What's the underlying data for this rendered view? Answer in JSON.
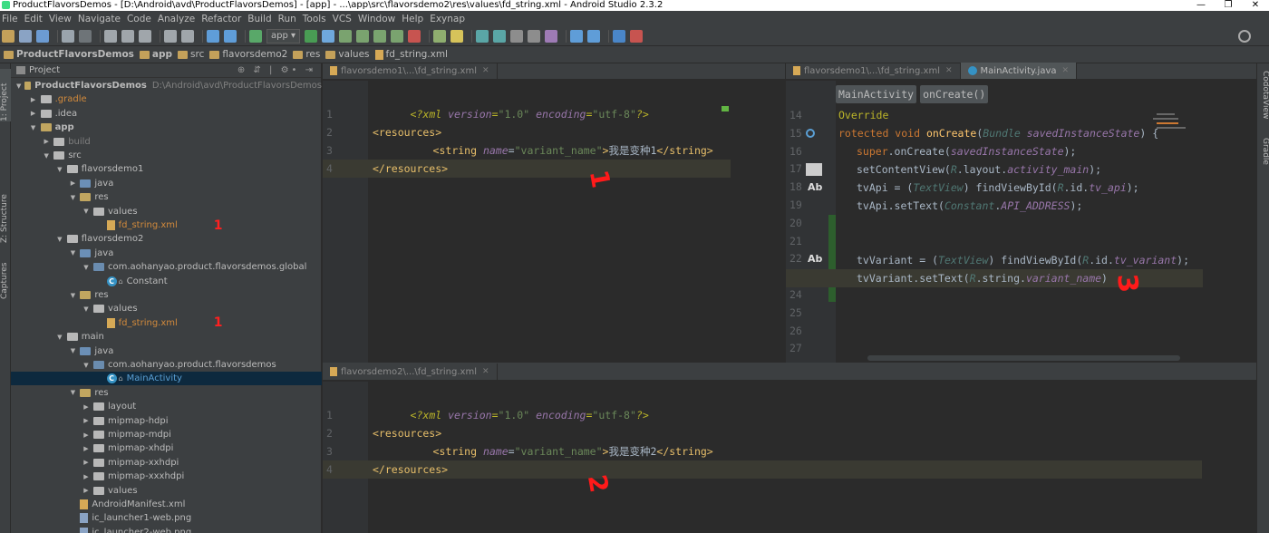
{
  "window": {
    "title": "ProductFlavorsDemos - [D:\\Android\\avd\\ProductFlavorsDemos] - [app] - ...\\app\\src\\flavorsdemo2\\res\\values\\fd_string.xml - Android Studio 2.3.2",
    "controls": [
      "—",
      "❐",
      "✕"
    ]
  },
  "menu": [
    "File",
    "Edit",
    "View",
    "Navigate",
    "Code",
    "Analyze",
    "Refactor",
    "Build",
    "Run",
    "Tools",
    "VCS",
    "Window",
    "Help",
    "Exynap"
  ],
  "toolbar": {
    "run_config": "app ▾"
  },
  "breadcrumb": [
    "ProductFlavorsDemos",
    "app",
    "src",
    "flavorsdemo2",
    "res",
    "values",
    "fd_string.xml"
  ],
  "left_strip": [
    "1: Project",
    "Z: Structure",
    "Captures"
  ],
  "right_strip": [
    "CodotaView",
    "Gradle"
  ],
  "project_panel": {
    "title": "Project",
    "header_icons": "⊕ ⇵ | ⚙• ⇥",
    "tree": [
      {
        "indent": 0,
        "arrow": "▼",
        "icon": "mod",
        "label": "ProductFlavorsDemos",
        "bold": true,
        "extra": "D:\\Android\\avd\\ProductFlavorsDemos"
      },
      {
        "indent": 1,
        "arrow": "▶",
        "icon": "folder",
        "label": ".gradle",
        "color": "orange"
      },
      {
        "indent": 1,
        "arrow": "▶",
        "icon": "folder",
        "label": ".idea"
      },
      {
        "indent": 1,
        "arrow": "▼",
        "icon": "mod",
        "label": "app",
        "bold": true
      },
      {
        "indent": 2,
        "arrow": "▶",
        "icon": "folder",
        "label": "build",
        "color": "muted"
      },
      {
        "indent": 2,
        "arrow": "▼",
        "icon": "folder",
        "label": "src"
      },
      {
        "indent": 3,
        "arrow": "▼",
        "icon": "folder",
        "label": "flavorsdemo1"
      },
      {
        "indent": 4,
        "arrow": "▶",
        "icon": "java",
        "label": "java"
      },
      {
        "indent": 4,
        "arrow": "▼",
        "icon": "res",
        "label": "res"
      },
      {
        "indent": 5,
        "arrow": "▼",
        "icon": "folder",
        "label": "values"
      },
      {
        "indent": 6,
        "arrow": "",
        "icon": "xml",
        "label": "fd_string.xml",
        "color": "orange",
        "mark": "1"
      },
      {
        "indent": 3,
        "arrow": "▼",
        "icon": "folder",
        "label": "flavorsdemo2"
      },
      {
        "indent": 4,
        "arrow": "▼",
        "icon": "java",
        "label": "java"
      },
      {
        "indent": 5,
        "arrow": "▼",
        "icon": "pkg",
        "label": "com.aohanyao.product.flavorsdemos.global"
      },
      {
        "indent": 6,
        "arrow": "",
        "icon": "class",
        "label": "Constant"
      },
      {
        "indent": 4,
        "arrow": "▼",
        "icon": "res",
        "label": "res"
      },
      {
        "indent": 5,
        "arrow": "▼",
        "icon": "folder",
        "label": "values"
      },
      {
        "indent": 6,
        "arrow": "",
        "icon": "xml",
        "label": "fd_string.xml",
        "color": "orange",
        "mark": "1"
      },
      {
        "indent": 3,
        "arrow": "▼",
        "icon": "folder",
        "label": "main"
      },
      {
        "indent": 4,
        "arrow": "▼",
        "icon": "java",
        "label": "java"
      },
      {
        "indent": 5,
        "arrow": "▼",
        "icon": "pkg",
        "label": "com.aohanyao.product.flavorsdemos"
      },
      {
        "indent": 6,
        "arrow": "",
        "icon": "class",
        "label": "MainActivity",
        "selected": true,
        "color": "blue"
      },
      {
        "indent": 4,
        "arrow": "▼",
        "icon": "res",
        "label": "res"
      },
      {
        "indent": 5,
        "arrow": "▶",
        "icon": "folder",
        "label": "layout"
      },
      {
        "indent": 5,
        "arrow": "▶",
        "icon": "folder",
        "label": "mipmap-hdpi"
      },
      {
        "indent": 5,
        "arrow": "▶",
        "icon": "folder",
        "label": "mipmap-mdpi"
      },
      {
        "indent": 5,
        "arrow": "▶",
        "icon": "folder",
        "label": "mipmap-xhdpi"
      },
      {
        "indent": 5,
        "arrow": "▶",
        "icon": "folder",
        "label": "mipmap-xxhdpi"
      },
      {
        "indent": 5,
        "arrow": "▶",
        "icon": "folder",
        "label": "mipmap-xxxhdpi"
      },
      {
        "indent": 5,
        "arrow": "▶",
        "icon": "folder",
        "label": "values"
      },
      {
        "indent": 4,
        "arrow": "",
        "icon": "xml",
        "label": "AndroidManifest.xml"
      },
      {
        "indent": 4,
        "arrow": "",
        "icon": "png",
        "label": "ic_launcher1-web.png"
      },
      {
        "indent": 4,
        "arrow": "",
        "icon": "png",
        "label": "ic_launcher2-web.png"
      }
    ]
  },
  "editor_left": {
    "tab": "flavorsdemo1\\...\\fd_string.xml",
    "lines": [
      "1",
      "2",
      "3",
      "4"
    ],
    "annotation": "1"
  },
  "editor_right": {
    "tabs": [
      "flavorsdemo1\\...\\fd_string.xml",
      "MainActivity.java"
    ],
    "breadcrumbs": [
      "MainActivity",
      "onCreate()"
    ],
    "line_numbers": [
      "14",
      "15",
      "16",
      "17",
      "18",
      "19",
      "20",
      "21",
      "22",
      "23",
      "24",
      "25",
      "26",
      "27"
    ],
    "gutter_marks": {
      "ab1": "Ab",
      "ab2": "Ab"
    },
    "annotation": "3"
  },
  "editor_bottom": {
    "tab": "flavorsdemo2\\...\\fd_string.xml",
    "lines": [
      "1",
      "2",
      "3",
      "4"
    ],
    "annotation": "2"
  },
  "code": {
    "xml_decl_open": "<?",
    "xml_decl_name": "xml",
    "attr_version": "version",
    "val_version": "\"1.0\"",
    "attr_encoding": "encoding",
    "val_encoding": "\"utf-8\"",
    "xml_decl_close": "?>",
    "res_open": "<resources>",
    "res_close": "</resources>",
    "string_open": "<string",
    "attr_name": "name",
    "val_name": "\"variant_name\"",
    "gt": ">",
    "string_close": "</string>",
    "text1": "我是变种1",
    "text2": "我是变种2",
    "eq": "=",
    "j14": "Override",
    "j15_kw": "rotected void ",
    "j15_fn": "onCreate",
    "j15_p1": "(",
    "j15_cls": "Bundle",
    "j15_param": " savedInstanceState",
    "j15_end": ") {",
    "j16_super": "super",
    "j16_rest": ".onCreate(",
    "j16_param": "savedInstanceState",
    "j16_end": ");",
    "j17_a": "setContentView(",
    "j17_r": "R",
    "j17_b": ".layout.",
    "j17_field": "activity_main",
    "j17_end": ");",
    "j18_a": "tvApi = (",
    "j18_cls": "TextView",
    "j18_b": ") findViewById(",
    "j18_r": "R",
    "j18_c": ".id.",
    "j18_field": "tv_api",
    "j18_end": ");",
    "j19_a": "tvApi.setText(",
    "j19_cls": "Constant",
    "j19_b": ".",
    "j19_field": "API_ADDRESS",
    "j19_end": ");",
    "j22_a": "tvVariant = (",
    "j22_cls": "TextView",
    "j22_b": ") findViewById(",
    "j22_r": "R",
    "j22_c": ".id.",
    "j22_field": "tv_variant",
    "j22_end": ");",
    "j23_a": "tvVariant.setText(",
    "j23_r": "R",
    "j23_b": ".string.",
    "j23_field": "variant_name",
    "j23_end": ")"
  },
  "colors": {
    "bg": "#2b2b2b",
    "panel": "#3c3f41",
    "keyword": "#cc7832",
    "tag": "#e8bf6a",
    "string": "#6a8759",
    "annotation_red": "#ff1a1a"
  }
}
